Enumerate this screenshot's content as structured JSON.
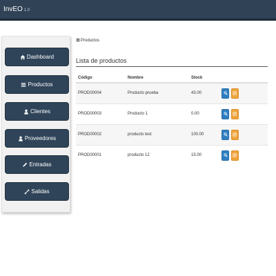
{
  "app": {
    "brand": "InvEO",
    "version": "1.0"
  },
  "sidebar": {
    "items": [
      {
        "label": "Dashboard",
        "icon": "home-icon"
      },
      {
        "label": "Productos",
        "icon": "list-icon"
      },
      {
        "label": "Clientes",
        "icon": "user-icon"
      },
      {
        "label": "Proveedores",
        "icon": "user-icon"
      },
      {
        "label": "Entradas",
        "icon": "pencil-icon"
      },
      {
        "label": "Salidas",
        "icon": "resize-arrows-icon"
      }
    ]
  },
  "breadcrumb": {
    "label": "Productos",
    "icon": "list-icon"
  },
  "main": {
    "title": "Lista de productos",
    "columns": [
      "Código",
      "Nombre",
      "Stock"
    ],
    "rows": [
      {
        "codigo": "PROD00004",
        "nombre": "Producto prueba",
        "stock": "43.00"
      },
      {
        "codigo": "PROD00003",
        "nombre": "Producto 1",
        "stock": "0.00"
      },
      {
        "codigo": "PROD00002",
        "nombre": "producto test",
        "stock": "100.00"
      },
      {
        "codigo": "PROD00001",
        "nombre": "producto 12",
        "stock": "15.00"
      }
    ]
  },
  "colors": {
    "topbar": "#2f4256",
    "nav_button": "#2f4459",
    "view_button": "#2f7fc1",
    "edit_button": "#f0a43c"
  }
}
